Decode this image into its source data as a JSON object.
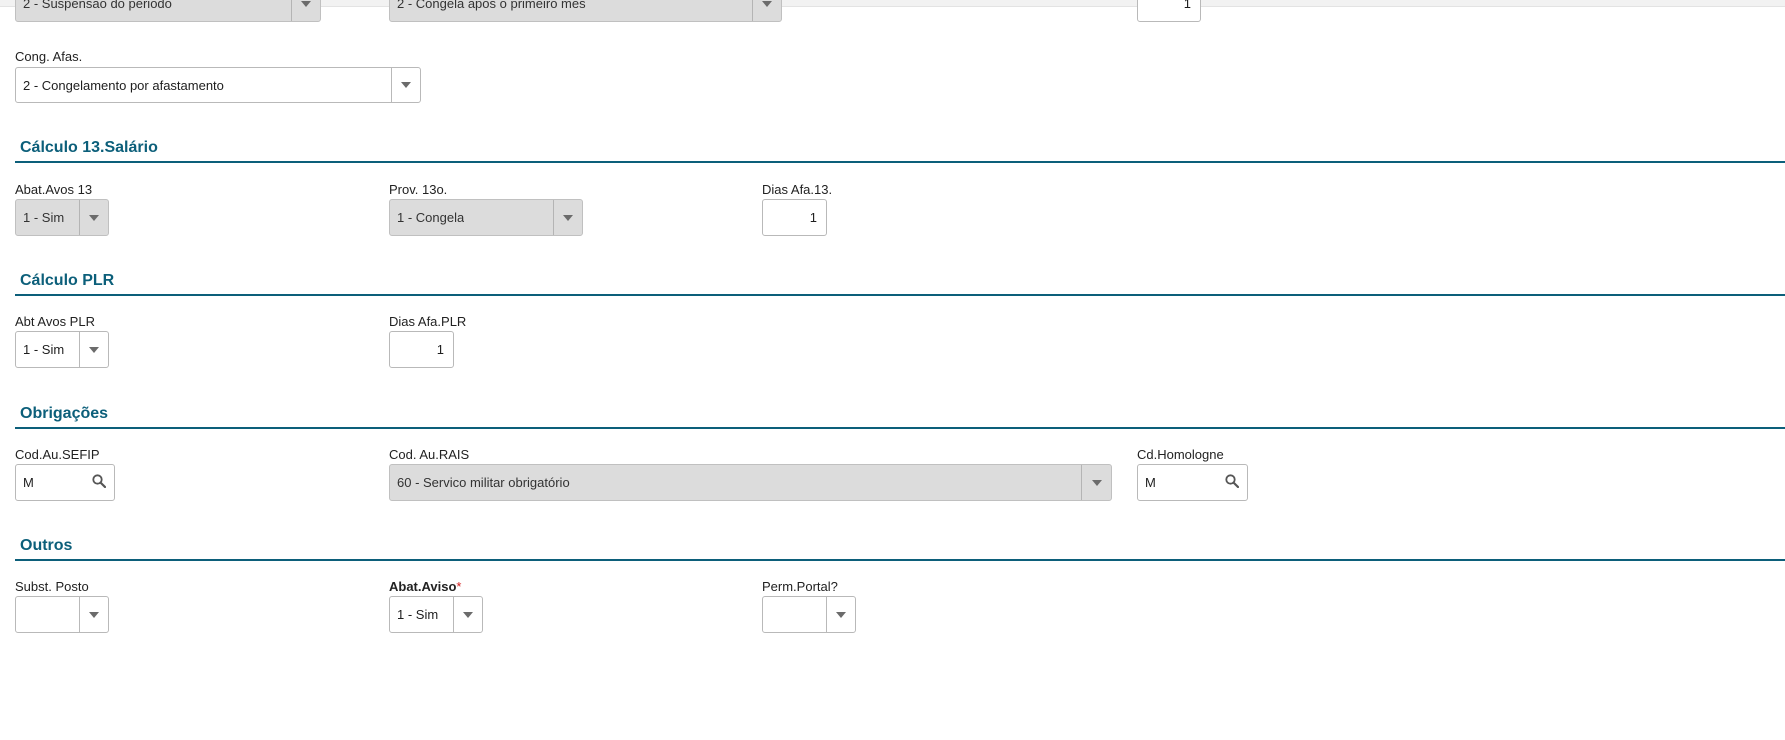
{
  "top_partial": {
    "field_a_value": "2 - Suspensao do periodo",
    "field_b_value": "2 - Congela apos o primeiro mes",
    "field_c_value": "1"
  },
  "cong_afas": {
    "label": "Cong. Afas.",
    "value": "2 - Congelamento por afastamento"
  },
  "calc13": {
    "title": "Cálculo 13.Salário",
    "abat_avos_13": {
      "label": "Abat.Avos 13",
      "value": "1 - Sim"
    },
    "prov_13o": {
      "label": "Prov. 13o.",
      "value": "1 - Congela"
    },
    "dias_afa_13": {
      "label": "Dias Afa.13.",
      "value": "1"
    }
  },
  "plr": {
    "title": "Cálculo PLR",
    "abt_avos_plr": {
      "label": "Abt Avos PLR",
      "value": "1 - Sim"
    },
    "dias_afa_plr": {
      "label": "Dias Afa.PLR",
      "value": "1"
    }
  },
  "obrigacoes": {
    "title": "Obrigações",
    "cod_au_sefip": {
      "label": "Cod.Au.SEFIP",
      "value": "M"
    },
    "cod_au_rais": {
      "label": "Cod. Au.RAIS",
      "value": "60 - Servico militar obrigatório"
    },
    "cd_homologne": {
      "label": "Cd.Homologne",
      "value": "M"
    }
  },
  "outros": {
    "title": "Outros",
    "subst_posto": {
      "label": "Subst. Posto",
      "value": ""
    },
    "abat_aviso": {
      "label": "Abat.Aviso",
      "required_mark": "*",
      "value": "1 - Sim"
    },
    "perm_portal": {
      "label": "Perm.Portal?",
      "value": ""
    }
  },
  "colors": {
    "section": "#0c5f7a",
    "required": "#d31c1c",
    "disabled_bg": "#dcdcdc"
  },
  "icons": {
    "dropdown": "chevron-down-icon",
    "lookup": "search-icon"
  }
}
